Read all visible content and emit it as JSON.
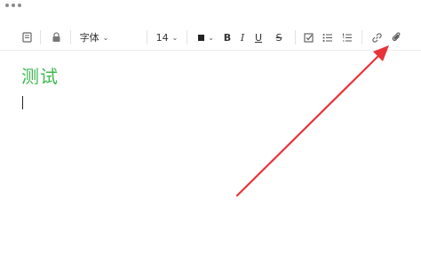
{
  "window": {
    "menu_dots_icon": "more-dots-icon"
  },
  "toolbar": {
    "font_family_label": "字体",
    "font_size_label": "14",
    "bold_label": "B",
    "italic_label": "I",
    "underline_label": "U",
    "strike_label": "S",
    "icons": [
      "book-icon",
      "lock-icon",
      "text-color-icon",
      "checkbox-icon",
      "bullet-list-icon",
      "numbered-list-icon",
      "link-icon",
      "attachment-icon"
    ]
  },
  "editor": {
    "text": "测试",
    "text_color": "#3fb950"
  },
  "annotation": {
    "arrow_color": "#e8333a"
  }
}
